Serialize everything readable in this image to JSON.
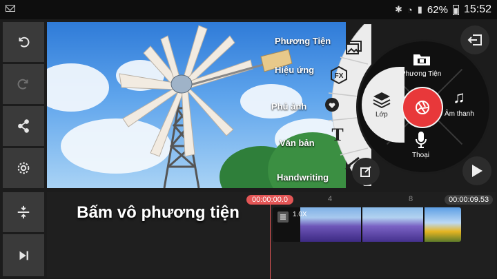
{
  "status_bar": {
    "battery": "62%",
    "time": "15:52"
  },
  "left_toolbar": {
    "items": [
      {
        "icon": "undo-icon"
      },
      {
        "icon": "redo-icon"
      },
      {
        "icon": "share-icon"
      },
      {
        "icon": "settings-icon"
      },
      {
        "icon": "split-icon"
      },
      {
        "icon": "skip-to-end-icon"
      }
    ]
  },
  "preview_menu": {
    "items": [
      "Phương Tiện",
      "Hiệu ứng",
      "Phủ ảnh",
      "Văn bản",
      "Handwriting"
    ]
  },
  "wheel": {
    "media_label": "Phương Tiện",
    "audio_label": "Âm thanh",
    "voice_label": "Thoại",
    "layer_label": "Lớp"
  },
  "timeline": {
    "start_time": "00:00:00.0",
    "end_time": "00:00:09.53",
    "ticks": [
      "4",
      "8"
    ],
    "clip_speed": "1.0X"
  },
  "hint": "Bấm vô phương tiện",
  "colors": {
    "accent_red": "#e8383a",
    "panel": "#3a3a3a",
    "background": "#1c1c1c"
  }
}
